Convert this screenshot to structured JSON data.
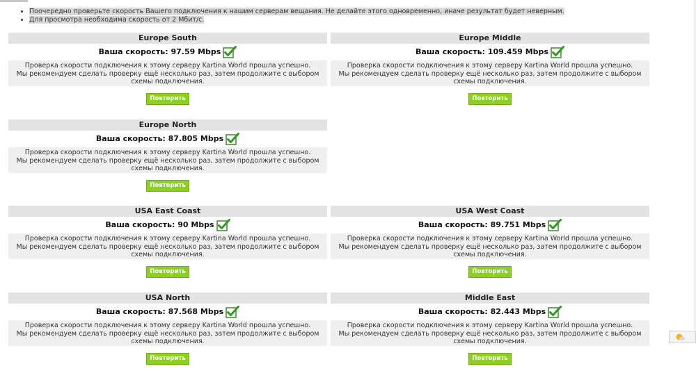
{
  "notes": [
    "Поочередно проверьте скорость Вашего подключения к нашим серверам вещания. Не делайте этого одновременно, иначе результат будет неверным.",
    "Для просмотра необходима скорость от 2 Мбит/с."
  ],
  "speed_prefix": "Ваша скорость:",
  "message_line1": "Проверка скорости подключения к этому серверу Kartina World прошла успешно.",
  "message_line2": "Мы рекомендуем сделать проверку ещё несколько раз, затем продолжите с выбором схемы подключения.",
  "retry_label": "Повторить",
  "accent_color": "#8cd024",
  "check_color": "#2c9a1e",
  "servers": [
    {
      "name": "Europe South",
      "speed": "97.59 Mbps"
    },
    {
      "name": "Europe Middle",
      "speed": "109.459 Mbps"
    },
    {
      "name": "Europe North",
      "speed": "87.805 Mbps"
    },
    {
      "name": "USA East Coast",
      "speed": "90 Mbps"
    },
    {
      "name": "USA West Coast",
      "speed": "89.751 Mbps"
    },
    {
      "name": "USA North",
      "speed": "87.568 Mbps"
    },
    {
      "name": "Middle East",
      "speed": "82.443 Mbps"
    }
  ]
}
